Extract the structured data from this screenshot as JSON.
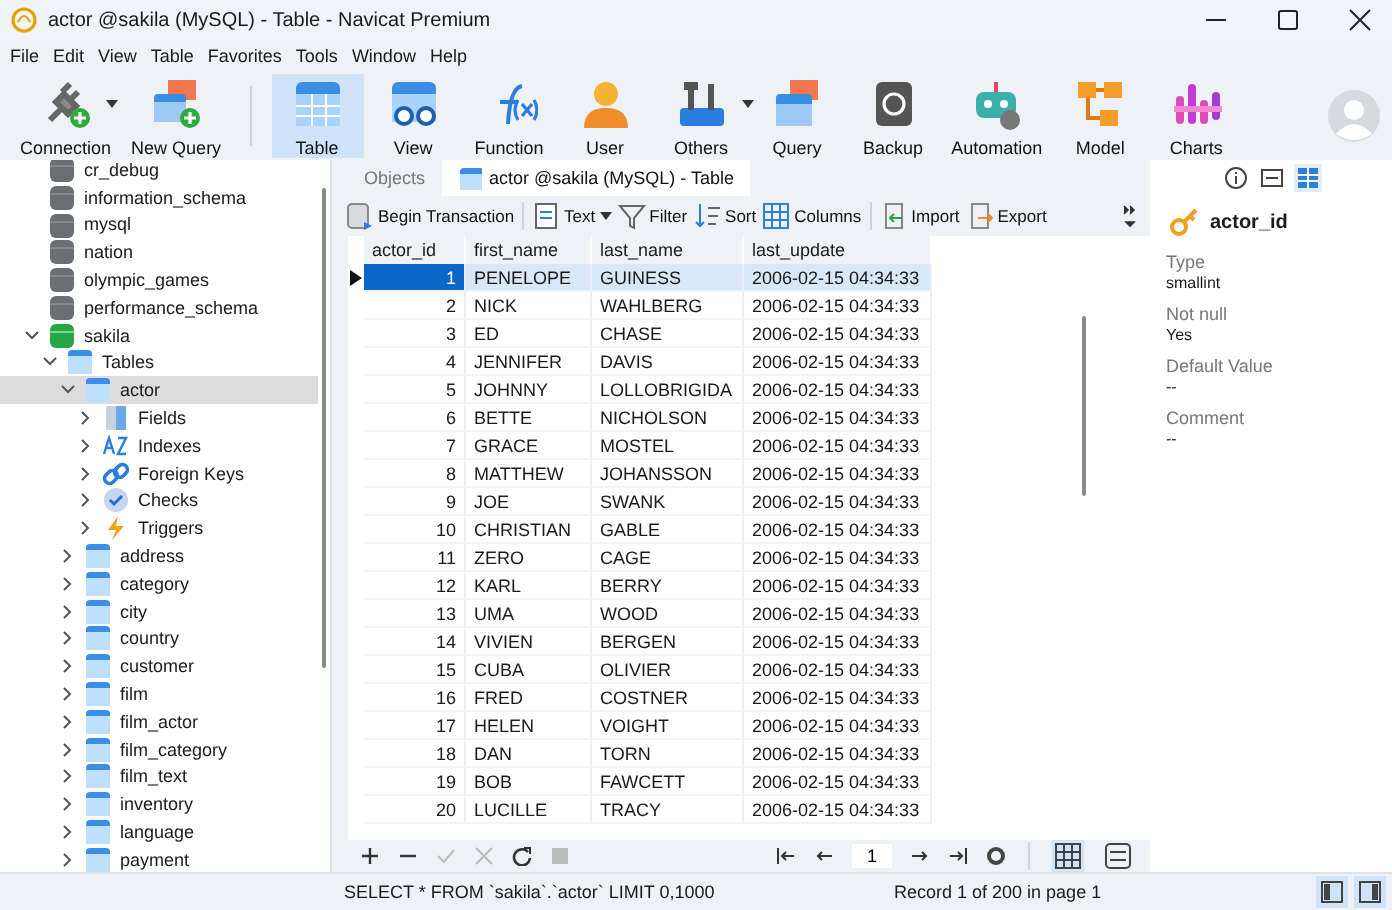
{
  "window": {
    "title": "actor @sakila (MySQL) - Table - Navicat Premium"
  },
  "menu": [
    "File",
    "Edit",
    "View",
    "Table",
    "Favorites",
    "Tools",
    "Window",
    "Help"
  ],
  "toolbar": [
    {
      "label": "Connection",
      "kind": "connection",
      "selected": false,
      "has_menu": true
    },
    {
      "label": "New Query",
      "kind": "newquery",
      "selected": false,
      "has_menu": false
    },
    {
      "label": "Table",
      "kind": "table",
      "selected": true,
      "has_menu": false
    },
    {
      "label": "View",
      "kind": "view",
      "selected": false,
      "has_menu": false
    },
    {
      "label": "Function",
      "kind": "function",
      "selected": false,
      "has_menu": false
    },
    {
      "label": "User",
      "kind": "user",
      "selected": false,
      "has_menu": false
    },
    {
      "label": "Others",
      "kind": "others",
      "selected": false,
      "has_menu": true
    },
    {
      "label": "Query",
      "kind": "query",
      "selected": false,
      "has_menu": false
    },
    {
      "label": "Backup",
      "kind": "backup",
      "selected": false,
      "has_menu": false
    },
    {
      "label": "Automation",
      "kind": "automation",
      "selected": false,
      "has_menu": false
    },
    {
      "label": "Model",
      "kind": "model",
      "selected": false,
      "has_menu": false
    },
    {
      "label": "Charts",
      "kind": "charts",
      "selected": false,
      "has_menu": false
    }
  ],
  "tree": [
    {
      "label": "cr_debug",
      "kind": "database",
      "selected": false
    },
    {
      "label": "information_schema",
      "kind": "database",
      "selected": false
    },
    {
      "label": "mysql",
      "kind": "database",
      "selected": false
    },
    {
      "label": "nation",
      "kind": "database",
      "selected": false
    },
    {
      "label": "olympic_games",
      "kind": "database",
      "selected": false
    },
    {
      "label": "performance_schema",
      "kind": "database",
      "selected": false
    },
    {
      "label": "sakila",
      "kind": "database_open",
      "selected": false,
      "expanded": true,
      "children": [
        {
          "label": "Tables",
          "kind": "tables",
          "selected": false,
          "expanded": true,
          "children": [
            {
              "label": "actor",
              "kind": "table",
              "selected": true,
              "expanded": true,
              "children": [
                {
                  "label": "Fields",
                  "kind": "fields",
                  "selected": false,
                  "expanded": false
                },
                {
                  "label": "Indexes",
                  "kind": "indexes",
                  "selected": false,
                  "expanded": false
                },
                {
                  "label": "Foreign Keys",
                  "kind": "foreign_keys",
                  "selected": false,
                  "expanded": false
                },
                {
                  "label": "Checks",
                  "kind": "checks",
                  "selected": false,
                  "expanded": false
                },
                {
                  "label": "Triggers",
                  "kind": "triggers",
                  "selected": false,
                  "expanded": false
                }
              ]
            },
            {
              "label": "address",
              "kind": "table",
              "selected": false,
              "expanded": false
            },
            {
              "label": "category",
              "kind": "table",
              "selected": false,
              "expanded": false
            },
            {
              "label": "city",
              "kind": "table",
              "selected": false,
              "expanded": false
            },
            {
              "label": "country",
              "kind": "table",
              "selected": false,
              "expanded": false
            },
            {
              "label": "customer",
              "kind": "table",
              "selected": false,
              "expanded": false
            },
            {
              "label": "film",
              "kind": "table",
              "selected": false,
              "expanded": false
            },
            {
              "label": "film_actor",
              "kind": "table",
              "selected": false,
              "expanded": false
            },
            {
              "label": "film_category",
              "kind": "table",
              "selected": false,
              "expanded": false
            },
            {
              "label": "film_text",
              "kind": "table",
              "selected": false,
              "expanded": false
            },
            {
              "label": "inventory",
              "kind": "table",
              "selected": false,
              "expanded": false
            },
            {
              "label": "language",
              "kind": "table",
              "selected": false,
              "expanded": false
            },
            {
              "label": "payment",
              "kind": "table",
              "selected": false,
              "expanded": false
            }
          ]
        }
      ]
    }
  ],
  "tabs": [
    {
      "label": "Objects",
      "kind": "plain",
      "selected": false
    },
    {
      "label": "actor @sakila (MySQL) - Table",
      "kind": "table",
      "selected": true
    }
  ],
  "table_toolbar": [
    {
      "label": "Begin Transaction",
      "kind": "transaction",
      "has_menu": false
    },
    {
      "label": "Text",
      "kind": "text",
      "has_menu": true
    },
    {
      "label": "Filter",
      "kind": "filter",
      "has_menu": false
    },
    {
      "label": "Sort",
      "kind": "sort",
      "has_menu": false
    },
    {
      "label": "Columns",
      "kind": "columns",
      "has_menu": false
    },
    {
      "label": "Import",
      "kind": "import",
      "has_menu": false
    },
    {
      "label": "Export",
      "kind": "export",
      "has_menu": false
    }
  ],
  "table": {
    "columns": [
      "actor_id",
      "first_name",
      "last_name",
      "last_update"
    ],
    "rows": [
      {
        "selected": true,
        "cells": [
          "1",
          "PENELOPE",
          "GUINESS",
          "2006-02-15 04:34:33"
        ]
      },
      {
        "selected": false,
        "cells": [
          "2",
          "NICK",
          "WAHLBERG",
          "2006-02-15 04:34:33"
        ]
      },
      {
        "selected": false,
        "cells": [
          "3",
          "ED",
          "CHASE",
          "2006-02-15 04:34:33"
        ]
      },
      {
        "selected": false,
        "cells": [
          "4",
          "JENNIFER",
          "DAVIS",
          "2006-02-15 04:34:33"
        ]
      },
      {
        "selected": false,
        "cells": [
          "5",
          "JOHNNY",
          "LOLLOBRIGIDA",
          "2006-02-15 04:34:33"
        ]
      },
      {
        "selected": false,
        "cells": [
          "6",
          "BETTE",
          "NICHOLSON",
          "2006-02-15 04:34:33"
        ]
      },
      {
        "selected": false,
        "cells": [
          "7",
          "GRACE",
          "MOSTEL",
          "2006-02-15 04:34:33"
        ]
      },
      {
        "selected": false,
        "cells": [
          "8",
          "MATTHEW",
          "JOHANSSON",
          "2006-02-15 04:34:33"
        ]
      },
      {
        "selected": false,
        "cells": [
          "9",
          "JOE",
          "SWANK",
          "2006-02-15 04:34:33"
        ]
      },
      {
        "selected": false,
        "cells": [
          "10",
          "CHRISTIAN",
          "GABLE",
          "2006-02-15 04:34:33"
        ]
      },
      {
        "selected": false,
        "cells": [
          "11",
          "ZERO",
          "CAGE",
          "2006-02-15 04:34:33"
        ]
      },
      {
        "selected": false,
        "cells": [
          "12",
          "KARL",
          "BERRY",
          "2006-02-15 04:34:33"
        ]
      },
      {
        "selected": false,
        "cells": [
          "13",
          "UMA",
          "WOOD",
          "2006-02-15 04:34:33"
        ]
      },
      {
        "selected": false,
        "cells": [
          "14",
          "VIVIEN",
          "BERGEN",
          "2006-02-15 04:34:33"
        ]
      },
      {
        "selected": false,
        "cells": [
          "15",
          "CUBA",
          "OLIVIER",
          "2006-02-15 04:34:33"
        ]
      },
      {
        "selected": false,
        "cells": [
          "16",
          "FRED",
          "COSTNER",
          "2006-02-15 04:34:33"
        ]
      },
      {
        "selected": false,
        "cells": [
          "17",
          "HELEN",
          "VOIGHT",
          "2006-02-15 04:34:33"
        ]
      },
      {
        "selected": false,
        "cells": [
          "18",
          "DAN",
          "TORN",
          "2006-02-15 04:34:33"
        ]
      },
      {
        "selected": false,
        "cells": [
          "19",
          "BOB",
          "FAWCETT",
          "2006-02-15 04:34:33"
        ]
      },
      {
        "selected": false,
        "cells": [
          "20",
          "LUCILLE",
          "TRACY",
          "2006-02-15 04:34:33"
        ]
      }
    ]
  },
  "page_field": {
    "value": "1"
  },
  "grid_views": [
    {
      "kind": "grid",
      "selected": true
    },
    {
      "kind": "form",
      "selected": false
    }
  ],
  "details": {
    "tabs": [
      {
        "kind": "info",
        "selected": false
      },
      {
        "kind": "ddl",
        "selected": false
      },
      {
        "kind": "grid",
        "selected": true
      }
    ],
    "field": "actor_id",
    "properties": [
      {
        "label": "Type",
        "value": "smallint"
      },
      {
        "label": "Not null",
        "value": "Yes"
      },
      {
        "label": "Default Value",
        "value": "--"
      },
      {
        "label": "Comment",
        "value": "--"
      }
    ]
  },
  "status_bar": {
    "sql": "SELECT * FROM `sakila`.`actor` LIMIT 0,1000",
    "record": "Record 1 of 200 in page 1",
    "panes": [
      {
        "kind": "left",
        "selected": true
      },
      {
        "kind": "right",
        "selected": true
      }
    ]
  }
}
